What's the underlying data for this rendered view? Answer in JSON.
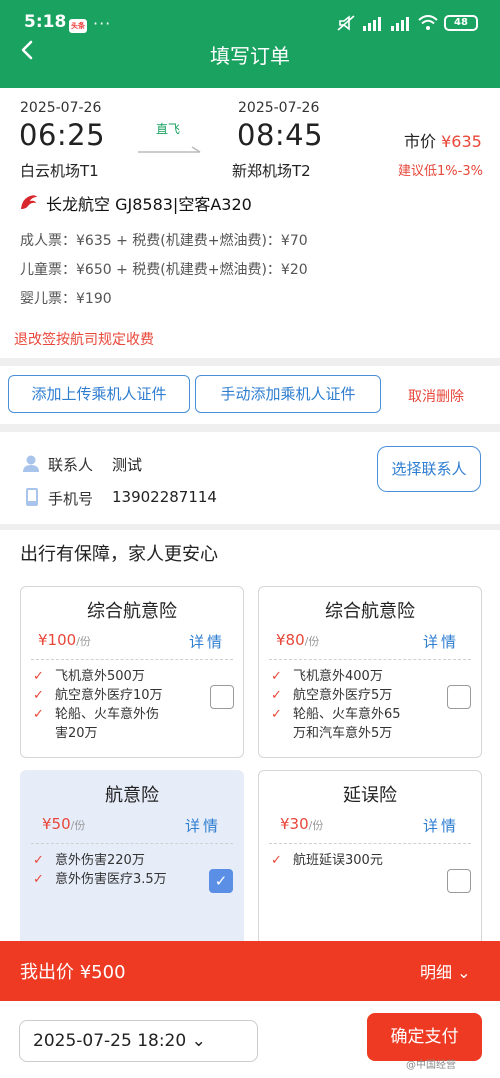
{
  "status_bar": {
    "time": "5:18",
    "app_badge": "头条",
    "dots": "···",
    "battery": "48"
  },
  "header": {
    "title": "填写订单"
  },
  "flight": {
    "depart_date": "2025-07-26",
    "depart_time": "06:25",
    "depart_airport": "白云机场T1",
    "direct_label": "直飞",
    "arrive_date": "2025-07-26",
    "arrive_time": "08:45",
    "arrive_airport": "新郑机场T2",
    "market_label": "市价",
    "market_price": "¥635",
    "advice": "建议低1%-3%",
    "airline": "长龙航空  GJ8583|空客A320",
    "fares": [
      "成人票：¥635  +  税费(机建费+燃油费)：¥70",
      "儿童票：¥650  +  税费(机建费+燃油费)：¥20",
      "婴儿票：¥190"
    ],
    "refund_rule": "退改签按航司规定收费"
  },
  "passengers": {
    "upload_label": "添加上传乘机人证件",
    "manual_label": "手动添加乘机人证件",
    "cancel_delete": "取消删除"
  },
  "contact": {
    "name_label": "联系人",
    "name_value": "测试",
    "phone_label": "手机号",
    "phone_value": "13902287114",
    "select_label": "选择联系人"
  },
  "insurance": {
    "heading": "出行有保障，家人更安心",
    "detail_label": "详情",
    "unit": "/份",
    "cards": [
      {
        "name": "综合航意险",
        "price": "¥100",
        "checked": false,
        "features": [
          "飞机意外500万",
          "航空意外医疗10万",
          "轮船、火车意外伤",
          "害20万"
        ]
      },
      {
        "name": "综合航意险",
        "price": "¥80",
        "checked": false,
        "features": [
          "飞机意外400万",
          "航空意外医疗5万",
          "轮船、火车意外65",
          "万和汽车意外5万"
        ]
      },
      {
        "name": "航意险",
        "price": "¥50",
        "checked": true,
        "features": [
          "意外伤害220万",
          "意外伤害医疗3.5万"
        ]
      },
      {
        "name": "延误险",
        "price": "¥30",
        "checked": false,
        "features": [
          "航班延误300元"
        ]
      }
    ]
  },
  "price_bar": {
    "label": "我出价 ¥500",
    "detail": "明细"
  },
  "pay_bar": {
    "date": "2025-07-25 18:20",
    "confirm": "确定支付"
  },
  "watermark": "@中国经营",
  "colors": {
    "brand_green": "#1aa260",
    "accent_red": "#ee3a23",
    "link_blue": "#2f7ed0"
  }
}
